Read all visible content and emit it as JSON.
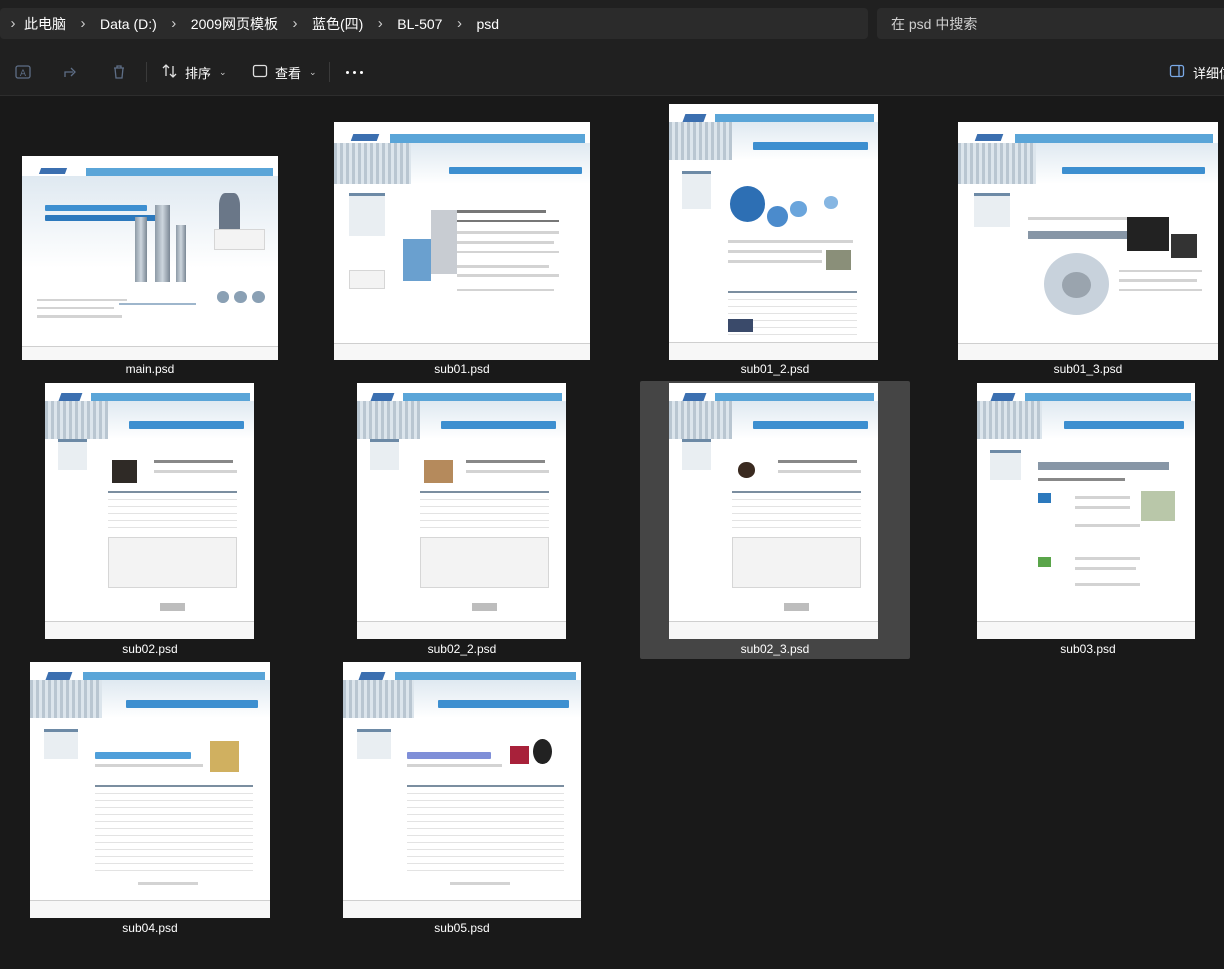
{
  "breadcrumb": {
    "items": [
      "此电脑",
      "Data (D:)",
      "2009网页模板",
      "蓝色(四)",
      "BL-507",
      "psd"
    ]
  },
  "search": {
    "placeholder": "在 psd 中搜索"
  },
  "commandbar": {
    "sort_label": "排序",
    "view_label": "查看",
    "details_label": "详细信"
  },
  "files": [
    {
      "name": "main.psd"
    },
    {
      "name": "sub01.psd"
    },
    {
      "name": "sub01_2.psd"
    },
    {
      "name": "sub01_3.psd"
    },
    {
      "name": "sub02.psd"
    },
    {
      "name": "sub02_2.psd"
    },
    {
      "name": "sub02_3.psd",
      "selected": true
    },
    {
      "name": "sub03.psd"
    },
    {
      "name": "sub04.psd"
    },
    {
      "name": "sub05.psd"
    }
  ],
  "icons": {
    "rename": "rename-icon",
    "share": "share-icon",
    "delete": "trash-icon",
    "sort": "sort-icon",
    "view": "view-icon",
    "more": "more-icon",
    "details": "details-pane-icon"
  },
  "colors": {
    "background": "#191919",
    "bar": "#202020",
    "field": "#2b2b2b",
    "selection": "#454545",
    "thumb_accent": "#5aa5d8"
  }
}
